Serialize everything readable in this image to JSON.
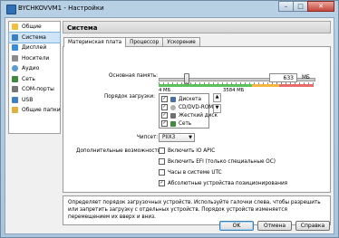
{
  "window": {
    "title": "BYCHKOVVM1 - Настройки",
    "controls": [
      "–",
      "□",
      "✕"
    ]
  },
  "sidebar": {
    "items": [
      {
        "label": "Общие",
        "icon": "general-icon",
        "color": "#f0c040"
      },
      {
        "label": "Система",
        "icon": "system-icon",
        "color": "#3a7fc4"
      },
      {
        "label": "Дисплей",
        "icon": "display-icon",
        "color": "#3c8dd8"
      },
      {
        "label": "Носители",
        "icon": "storage-icon",
        "color": "#8d8d8d"
      },
      {
        "label": "Аудио",
        "icon": "audio-icon",
        "color": "#5a9bd0"
      },
      {
        "label": "Сеть",
        "icon": "network-icon",
        "color": "#3f8a3f"
      },
      {
        "label": "COM-порты",
        "icon": "com-port-icon",
        "color": "#777777"
      },
      {
        "label": "USB",
        "icon": "usb-icon",
        "color": "#4080c0"
      },
      {
        "label": "Общие папки",
        "icon": "shared-folder-icon",
        "color": "#e0b040"
      }
    ],
    "selected_index": 1
  },
  "page": {
    "title": "Система"
  },
  "tabs": [
    {
      "label": "Материнская плата",
      "active": true
    },
    {
      "label": "Процессор",
      "active": false
    },
    {
      "label": "Ускорение",
      "active": false
    }
  ],
  "motherboard": {
    "memory_label": "Основная память:",
    "memory_value": "633",
    "memory_unit": "МБ",
    "memory_min": "4 МБ",
    "memory_max": "3584 МБ",
    "memory_fraction": 0.176,
    "boot_label": "Порядок загрузки:",
    "boot_items": [
      {
        "label": "Дискета",
        "checked": true,
        "icon": "floppy-icon",
        "color": "#4a6fa5"
      },
      {
        "label": "CD/DVD-ROM",
        "checked": true,
        "icon": "cd-icon",
        "color": "#b0b0b0"
      },
      {
        "label": "Жесткий диск",
        "checked": true,
        "icon": "hard-disk-icon",
        "color": "#707070"
      },
      {
        "label": "Сеть",
        "checked": true,
        "icon": "network-icon",
        "color": "#3f8a3f"
      }
    ],
    "chipset_label": "Чипсет:",
    "chipset_value": "PIIX3",
    "extra_label": "Дополнительные возможности:",
    "options": [
      {
        "label": "Включить IO APIC",
        "checked": false
      },
      {
        "label": "Включить EFI (только специальные ОС)",
        "checked": false
      },
      {
        "label": "Часы в системе UTC",
        "checked": false
      },
      {
        "label": "Абсолютные устройства позиционирования",
        "checked": true
      }
    ]
  },
  "description": "Определяет порядок загрузочных устройств. Используйте галочки слева, чтобы разрешить или запретить загрузку с отдельных устройств. Порядок устройств изменяется перемещением их вверх и вниз.",
  "buttons": {
    "ok": "OK",
    "cancel": "Отмена",
    "help": "Справка"
  }
}
